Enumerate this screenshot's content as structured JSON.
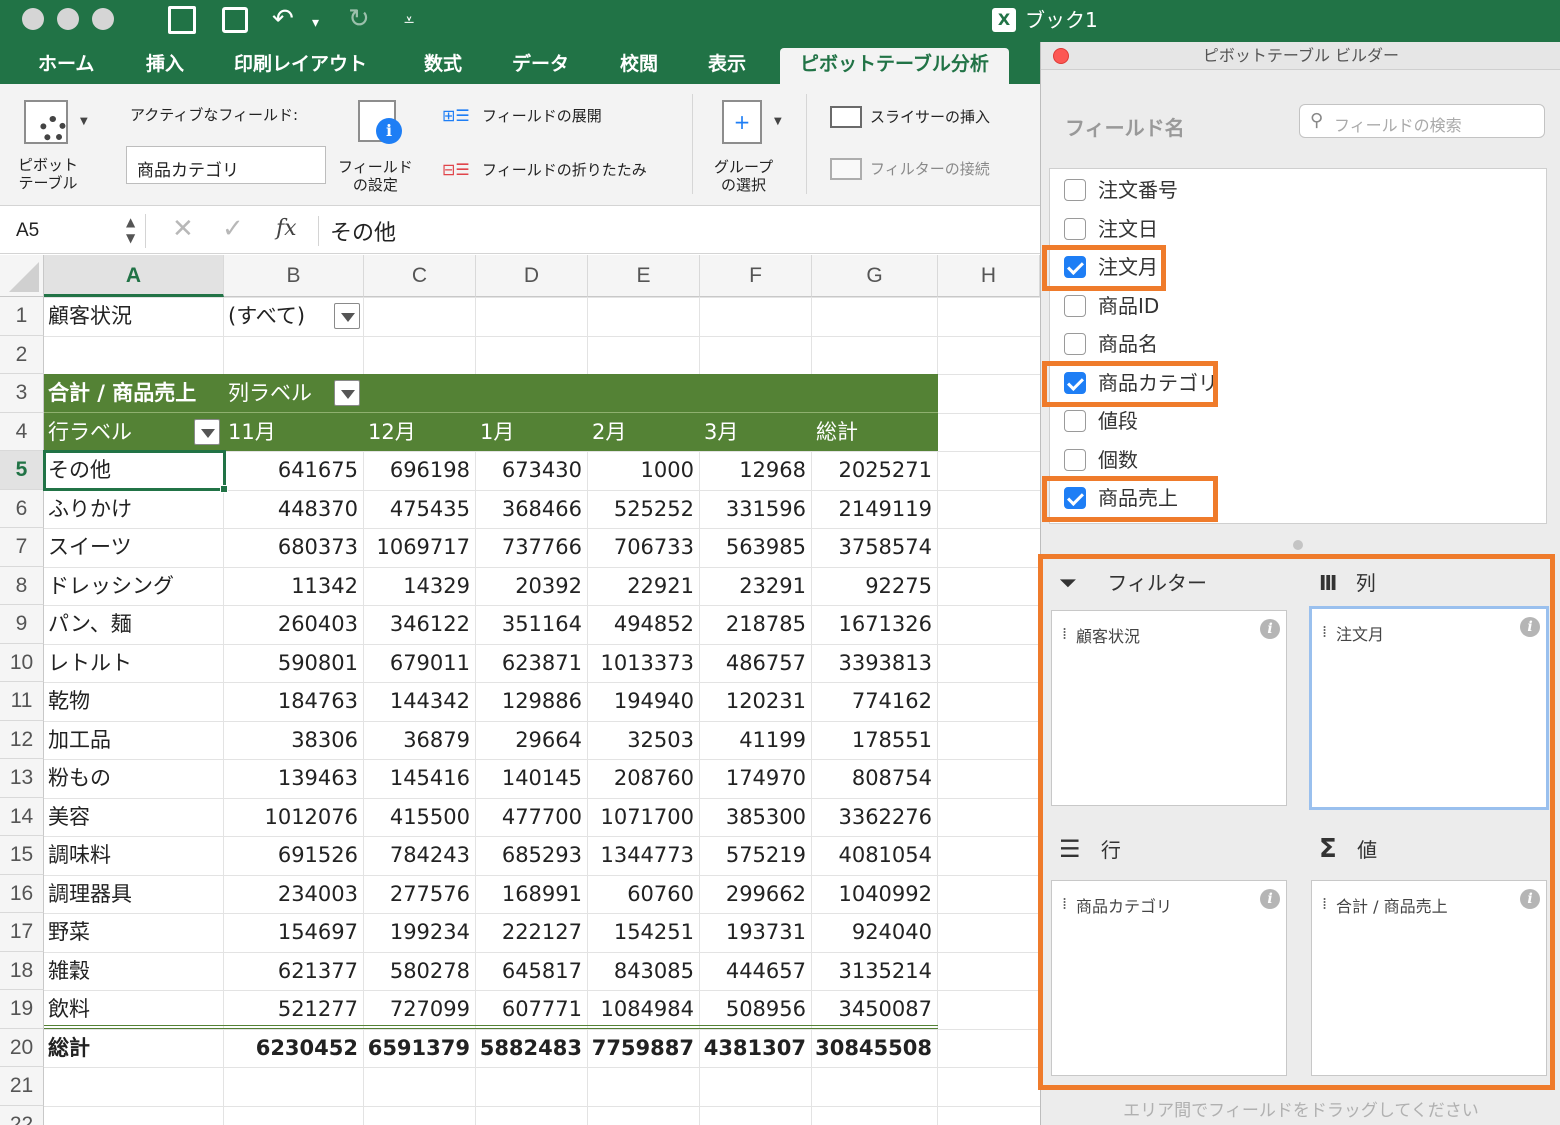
{
  "window": {
    "title": "ブック1"
  },
  "tabs": [
    "ホーム",
    "挿入",
    "印刷レイアウト",
    "数式",
    "データ",
    "校閲",
    "表示",
    "ピボットテーブル分析"
  ],
  "ribbon": {
    "pivot_table": "ピボット\nテーブル",
    "active_field_label": "アクティブなフィールド:",
    "active_field_value": "商品カテゴリ",
    "field_settings": "フィールド\nの設定",
    "expand_field": "フィールドの展開",
    "collapse_field": "フィールドの折りたたみ",
    "group_selection": "グループ\nの選択",
    "insert_slicer": "スライサーの挿入",
    "filter_connections": "フィルターの接続"
  },
  "formula_bar": {
    "name_box": "A5",
    "fx": "fx",
    "content": "その他"
  },
  "grid": {
    "columns": [
      "A",
      "B",
      "C",
      "D",
      "E",
      "F",
      "G",
      "H"
    ],
    "selected_column": "A",
    "selected_row": "5",
    "row_numbers": [
      "1",
      "2",
      "3",
      "4",
      "5",
      "6",
      "7",
      "8",
      "9",
      "10",
      "11",
      "12",
      "13",
      "14",
      "15",
      "16",
      "17",
      "18",
      "19",
      "20",
      "21",
      "22"
    ],
    "filter_label": "顧客状況",
    "filter_value": "(すべて)",
    "pivot_header": "合計 / 商品売上",
    "col_labels_caption": "列ラベル",
    "row_labels_caption": "行ラベル",
    "month_headers": [
      "11月",
      "12月",
      "1月",
      "2月",
      "3月",
      "総計"
    ],
    "rows": [
      {
        "label": "その他",
        "values": [
          "641675",
          "696198",
          "673430",
          "1000",
          "12968",
          "2025271"
        ]
      },
      {
        "label": "ふりかけ",
        "values": [
          "448370",
          "475435",
          "368466",
          "525252",
          "331596",
          "2149119"
        ]
      },
      {
        "label": "スイーツ",
        "values": [
          "680373",
          "1069717",
          "737766",
          "706733",
          "563985",
          "3758574"
        ]
      },
      {
        "label": "ドレッシング",
        "values": [
          "11342",
          "14329",
          "20392",
          "22921",
          "23291",
          "92275"
        ]
      },
      {
        "label": "パン、麺",
        "values": [
          "260403",
          "346122",
          "351164",
          "494852",
          "218785",
          "1671326"
        ]
      },
      {
        "label": "レトルト",
        "values": [
          "590801",
          "679011",
          "623871",
          "1013373",
          "486757",
          "3393813"
        ]
      },
      {
        "label": "乾物",
        "values": [
          "184763",
          "144342",
          "129886",
          "194940",
          "120231",
          "774162"
        ]
      },
      {
        "label": "加工品",
        "values": [
          "38306",
          "36879",
          "29664",
          "32503",
          "41199",
          "178551"
        ]
      },
      {
        "label": "粉もの",
        "values": [
          "139463",
          "145416",
          "140145",
          "208760",
          "174970",
          "808754"
        ]
      },
      {
        "label": "美容",
        "values": [
          "1012076",
          "415500",
          "477700",
          "1071700",
          "385300",
          "3362276"
        ]
      },
      {
        "label": "調味料",
        "values": [
          "691526",
          "784243",
          "685293",
          "1344773",
          "575219",
          "4081054"
        ]
      },
      {
        "label": "調理器具",
        "values": [
          "234003",
          "277576",
          "168991",
          "60760",
          "299662",
          "1040992"
        ]
      },
      {
        "label": "野菜",
        "values": [
          "154697",
          "199234",
          "222127",
          "154251",
          "193731",
          "924040"
        ]
      },
      {
        "label": "雑穀",
        "values": [
          "621377",
          "580278",
          "645817",
          "843085",
          "444657",
          "3135214"
        ]
      },
      {
        "label": "飲料",
        "values": [
          "521277",
          "727099",
          "607771",
          "1084984",
          "508956",
          "3450087"
        ]
      }
    ],
    "total_row": {
      "label": "総計",
      "values": [
        "6230452",
        "6591379",
        "5882483",
        "7759887",
        "4381307",
        "30845508"
      ]
    }
  },
  "builder": {
    "title": "ピボットテーブル ビルダー",
    "field_name_label": "フィールド名",
    "search_placeholder": "フィールドの検索",
    "fields": [
      {
        "name": "注文番号",
        "checked": false
      },
      {
        "name": "注文日",
        "checked": false
      },
      {
        "name": "注文月",
        "checked": true
      },
      {
        "name": "商品ID",
        "checked": false
      },
      {
        "name": "商品名",
        "checked": false
      },
      {
        "name": "商品カテゴリ",
        "checked": true
      },
      {
        "name": "値段",
        "checked": false
      },
      {
        "name": "個数",
        "checked": false
      },
      {
        "name": "商品売上",
        "checked": true
      }
    ],
    "areas": {
      "filter": {
        "title": "フィルター",
        "item": "顧客状況"
      },
      "columns": {
        "title": "列",
        "item": "注文月"
      },
      "rows": {
        "title": "行",
        "item": "商品カテゴリ"
      },
      "values": {
        "title": "値",
        "item": "合計 / 商品売上"
      }
    },
    "footer_hint": "エリア間でフィールドをドラッグしてください"
  },
  "colors": {
    "excel_green": "#217346",
    "pivot_header": "#548235",
    "highlight": "#ef7b2b",
    "checkbox": "#1e7ef5"
  }
}
